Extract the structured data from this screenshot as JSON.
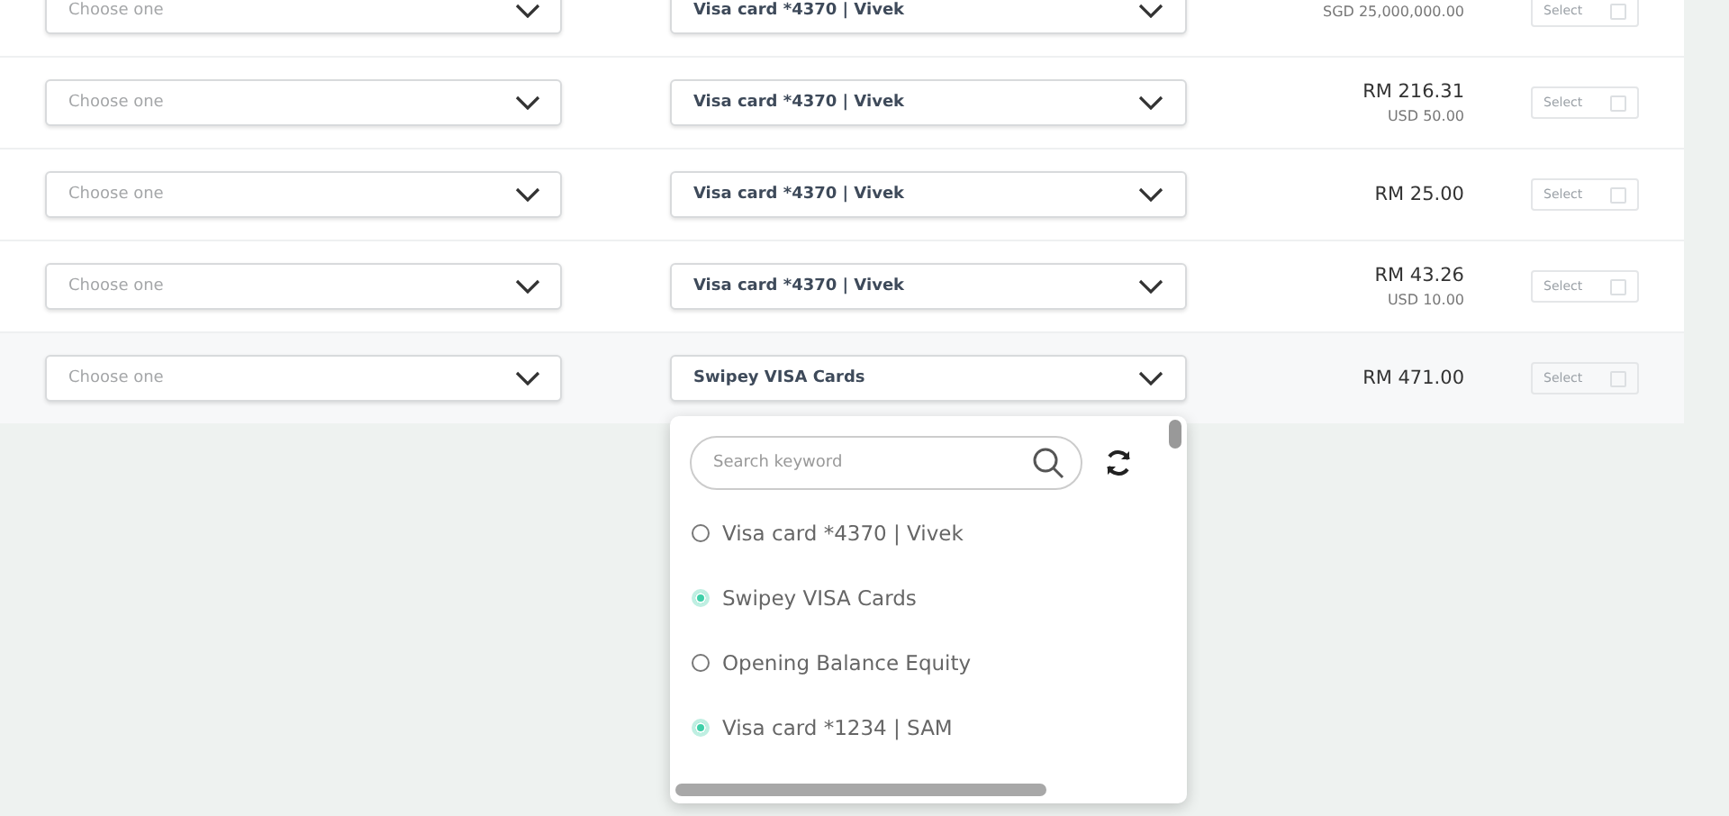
{
  "rows": [
    {
      "account": {
        "placeholder": "Choose one"
      },
      "payment": "Visa card *4370 | Vivek",
      "amount": null,
      "secondary": "SGD 25,000,000.00",
      "select": "Select",
      "checked": false,
      "highlighted": false
    },
    {
      "account": {
        "placeholder": "Choose one"
      },
      "payment": "Visa card *4370 | Vivek",
      "amount": "RM 216.31",
      "secondary": "USD 50.00",
      "select": "Select",
      "checked": false,
      "highlighted": false
    },
    {
      "account": {
        "placeholder": "Choose one"
      },
      "payment": "Visa card *4370 | Vivek",
      "amount": "RM 25.00",
      "secondary": null,
      "select": "Select",
      "checked": false,
      "highlighted": false
    },
    {
      "account": {
        "placeholder": "Choose one"
      },
      "payment": "Visa card *4370 | Vivek",
      "amount": "RM 43.26",
      "secondary": "USD 10.00",
      "select": "Select",
      "checked": false,
      "highlighted": false
    },
    {
      "account": {
        "placeholder": "Choose one"
      },
      "payment": "Swipey VISA Cards",
      "amount": "RM 471.00",
      "secondary": null,
      "select": "Select",
      "checked": false,
      "highlighted": true
    }
  ],
  "dropdown": {
    "search": {
      "placeholder": "Search keyword"
    },
    "options": [
      {
        "label": "Visa card *4370 | Vivek",
        "selected": false
      },
      {
        "label": "Swipey VISA Cards",
        "selected": true
      },
      {
        "label": "Opening Balance Equity",
        "selected": false
      },
      {
        "label": "Visa card *1234 | SAM",
        "selected": true
      }
    ]
  }
}
